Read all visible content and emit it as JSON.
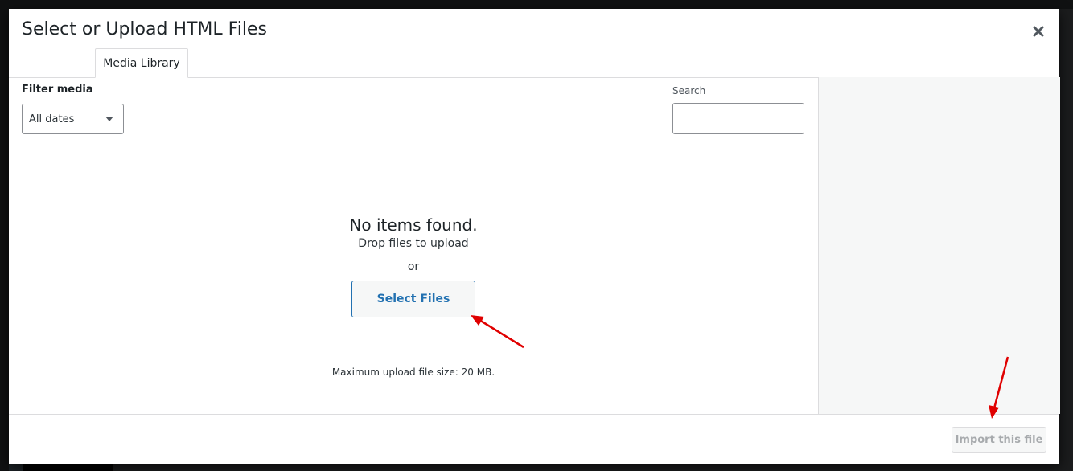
{
  "modal": {
    "title": "Select or Upload HTML Files",
    "close_icon": "close-icon"
  },
  "tabs": [
    {
      "label": "Media Library",
      "active": true
    }
  ],
  "toolbar": {
    "filter_label": "Filter media",
    "date_filter": {
      "selected": "All dates"
    },
    "search_label": "Search",
    "search_value": ""
  },
  "empty_state": {
    "title": "No items found.",
    "drop_text": "Drop files to upload",
    "or_text": "or",
    "select_button": "Select Files",
    "max_upload": "Maximum upload file size: 20 MB."
  },
  "footer": {
    "import_button": "Import this file",
    "import_disabled": true
  },
  "colors": {
    "accent": "#2271b1",
    "annotation_arrow": "#e00000"
  }
}
